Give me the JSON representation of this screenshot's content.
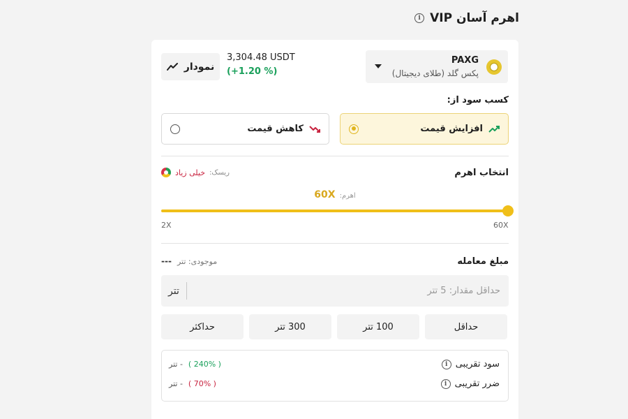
{
  "page": {
    "title": "اهرم آسان VIP"
  },
  "asset": {
    "symbol": "PAXG",
    "name": "پکس گلد (طلای دیجیتال)",
    "price": "3,304.48 USDT",
    "change": "(+1.20 %)",
    "icon": "paxg-coin-icon"
  },
  "chart_button": {
    "label": "نمودار",
    "icon": "trend-line-icon"
  },
  "direction": {
    "label": "کسب سود از:",
    "options": [
      {
        "label": "افزایش قیمت",
        "selected": true,
        "icon": "trend-up-icon",
        "color": "#1aa05b"
      },
      {
        "label": "کاهش قیمت",
        "selected": false,
        "icon": "trend-down-icon",
        "color": "#c8233f"
      }
    ]
  },
  "leverage": {
    "section_label": "انتخاب اهرم",
    "risk_label": "ریسک:",
    "risk_value": "خیلی زیاد",
    "current_label": "اهرم:",
    "current_value": "60X",
    "min_label": "2X",
    "max_label": "60X",
    "min": 2,
    "max": 60,
    "value": 60,
    "accent_color": "#f0bf19"
  },
  "amount": {
    "section_label": "مبلغ معامله",
    "balance_label": "موجودی: تتر",
    "balance_value": "---",
    "placeholder": "حداقل مقدار: 5 تتر",
    "unit": "تتر",
    "quick_buttons": [
      "حداقل",
      "100 تتر",
      "300 تتر",
      "حداکثر"
    ]
  },
  "estimates": {
    "profit_label": "سود تقریبی",
    "profit_pct": "( 240% )",
    "profit_amount": "- تتر",
    "loss_label": "ضرر تقریبی",
    "loss_pct": "( 70% )",
    "loss_amount": "- تتر"
  }
}
